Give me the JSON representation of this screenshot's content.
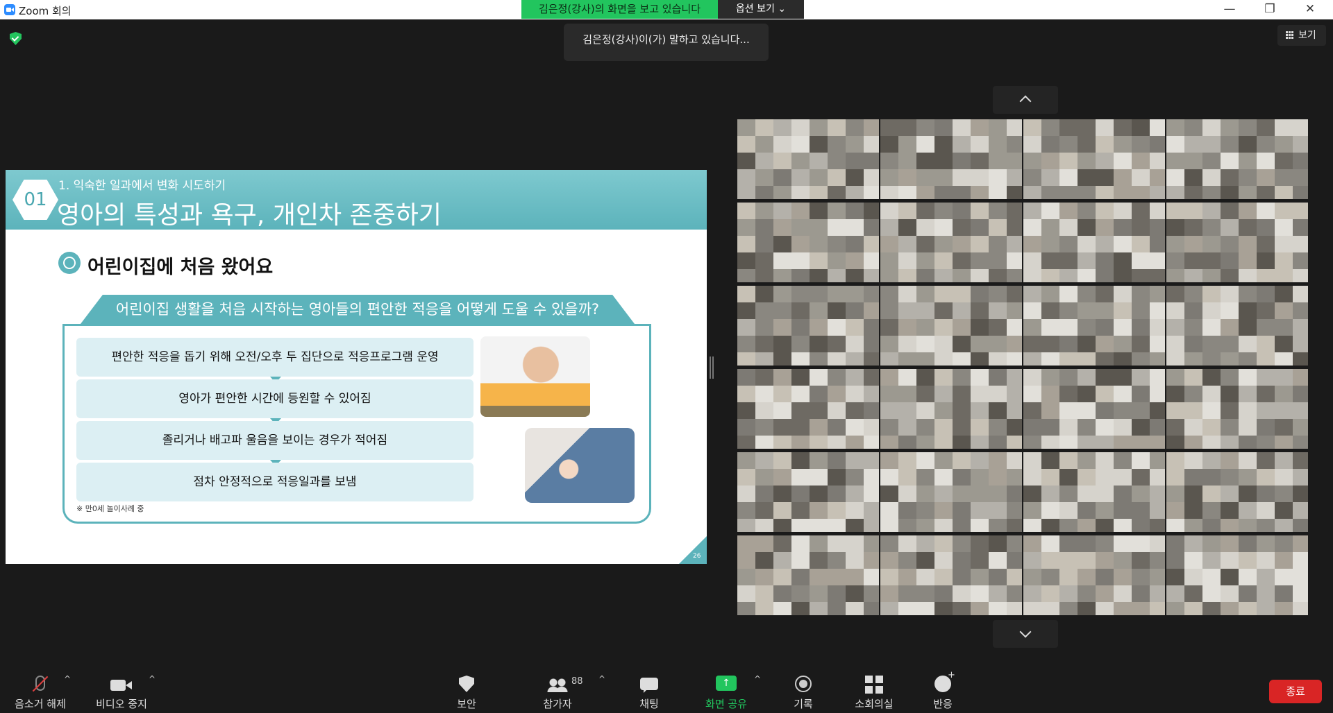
{
  "app": {
    "title": "Zoom 회의",
    "share_banner": "김은정(강사)의 화면을 보고 있습니다",
    "options_label": "옵션 보기 ⌄",
    "speaking": "김은정(강사)이(가) 말하고 있습니다...",
    "view_label": "보기"
  },
  "window_controls": [
    "—",
    "❐",
    "✕"
  ],
  "slide": {
    "number": "01",
    "subtitle": "1. 익숙한 일과에서 변화 시도하기",
    "title": "영아의 특성과 욕구, 개인차 존중하기",
    "heading": "어린이집에 처음 왔어요",
    "banner": "어린이집 생활을 처음 시작하는 영아들의 편안한 적응을 어떻게 도울 수 있을까?",
    "steps": [
      "편안한 적응을 돕기 위해 오전/오후 두 집단으로 적응프로그램 운영",
      "영아가 편안한 시간에 등원할 수 있어짐",
      "졸리거나 배고파 울음을 보이는 경우가 적어짐",
      "점차 안정적으로  적응일과를 보냄"
    ],
    "note": "※ 만0세 놀이사례 중",
    "page": "26"
  },
  "participant_count": "88",
  "toolbar": {
    "mute": "음소거 해제",
    "video": "비디오 중지",
    "security": "보안",
    "participants": "참가자",
    "chat": "채팅",
    "share": "화면 공유",
    "record": "기록",
    "breakout": "소회의실",
    "reactions": "반응",
    "end": "종료"
  },
  "colors": {
    "accent": "#22c55e",
    "slide_teal": "#5cb3bb",
    "end": "#d92525"
  },
  "icons": [
    "zoom-logo-icon",
    "shield-icon",
    "grid-icon",
    "microphone-muted-icon",
    "camera-icon",
    "security-shield-icon",
    "participants-icon",
    "chat-icon",
    "share-screen-icon",
    "record-icon",
    "breakout-rooms-icon",
    "reactions-icon"
  ]
}
